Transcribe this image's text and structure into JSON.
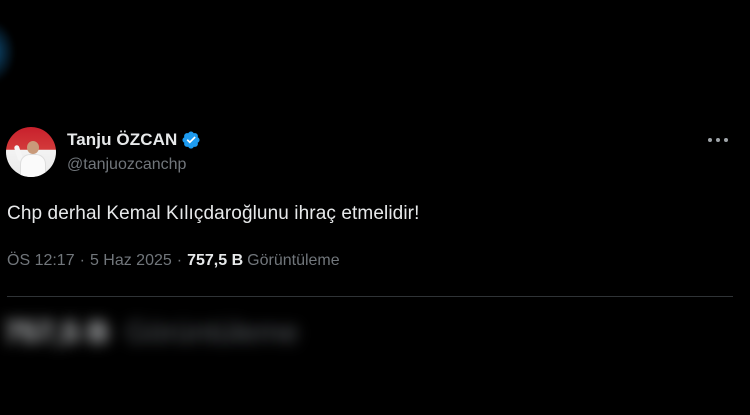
{
  "tweet": {
    "display_name": "Tanju ÖZCAN",
    "handle": "@tanjuozcanchp",
    "text": "Chp derhal Kemal Kılıçdaroğlunu ihraç etmelidir!",
    "time": "ÖS 12:17",
    "date": "5 Haz 2025",
    "separator": "·",
    "views_count": "757,5 B",
    "views_label": "Görüntüleme",
    "verified": true,
    "verified_color": "#1d9bf0"
  },
  "icons": {
    "verified": "verified-badge-icon",
    "more": "more-options-icon"
  },
  "blurred_stats": {
    "count": "757,5 B",
    "label": "Görüntüleme"
  },
  "colors": {
    "background": "#000000",
    "text_primary": "#e7e9ea",
    "text_secondary": "#71767b",
    "divider": "#2f3336",
    "accent": "#1d9bf0"
  }
}
